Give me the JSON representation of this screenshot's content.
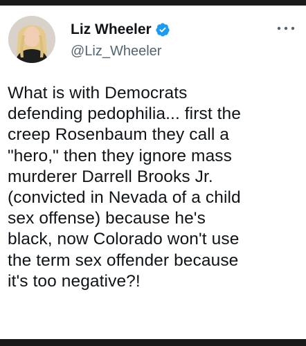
{
  "author": {
    "display_name": "Liz Wheeler",
    "handle": "@Liz_Wheeler",
    "verified": true,
    "avatar_icon": "profile-photo",
    "badge_color": "#1d9bf0"
  },
  "menu_icon": "more-horizontal-icon",
  "tweet": {
    "text": "What is with Democrats\ndefending pedophilia... first the\ncreep Rosenbaum they call a\n\"hero,\" then they ignore mass\nmurderer Darrell Brooks Jr.\n(convicted in Nevada of a child\nsex offense) because he's\nblack, now Colorado won't use\nthe term sex offender because\nit's too negative?!"
  }
}
